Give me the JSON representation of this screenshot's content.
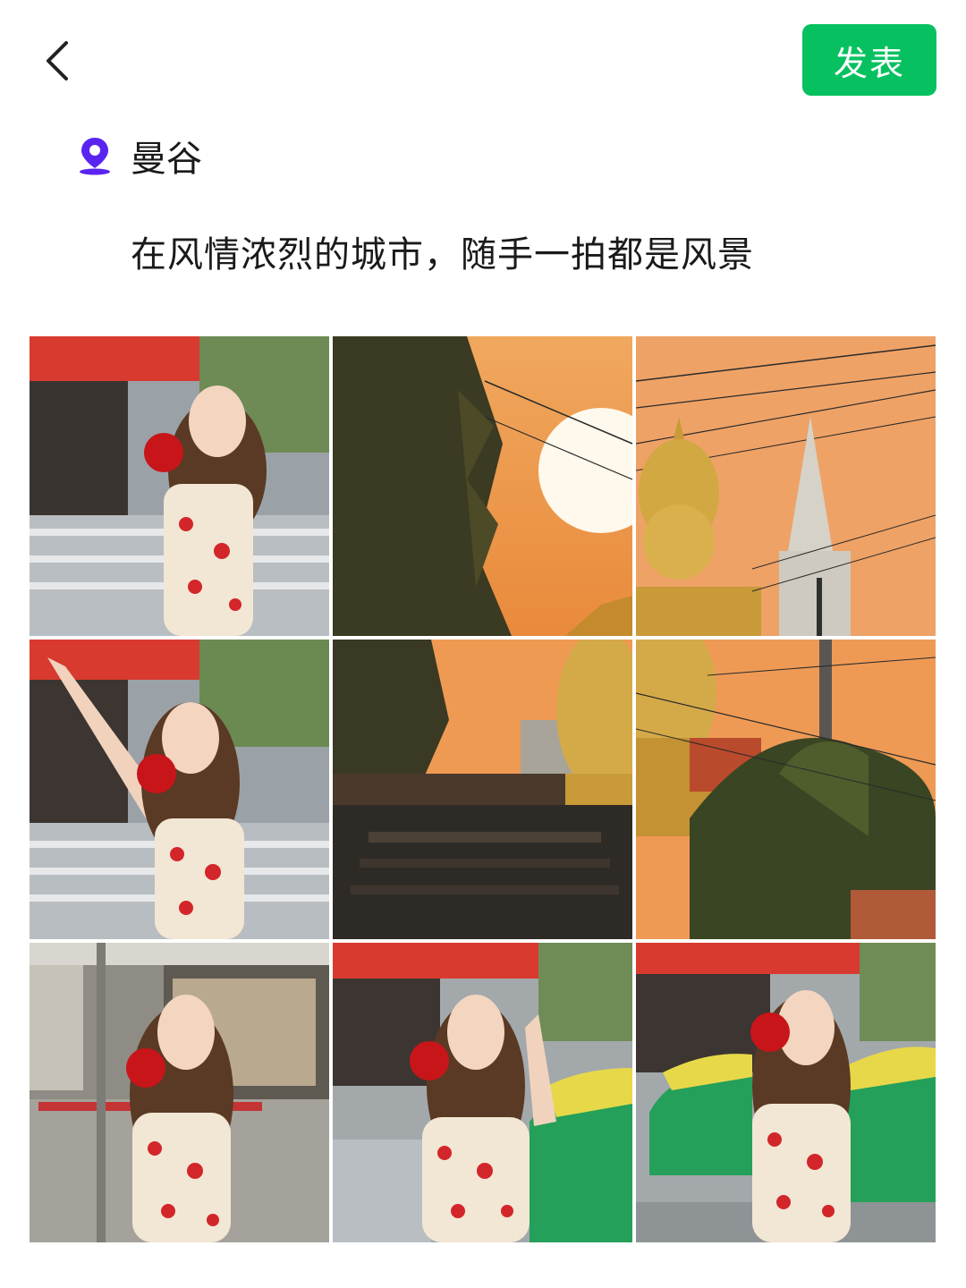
{
  "header": {
    "publish_label": "发表"
  },
  "post": {
    "location": "曼谷",
    "caption": "在风情浓烈的城市，随手一拍都是风景"
  },
  "icons": {
    "back": "chevron-left-icon",
    "location": "location-pin-icon"
  },
  "colors": {
    "accent_green": "#07c160",
    "location_purple": "#5a24f0"
  },
  "photos": [
    "street-portrait-photo",
    "sunset-sun-photo",
    "buddha-temple-photo",
    "street-portrait-waving-photo",
    "sunset-rooftops-photo",
    "powerlines-trees-photo",
    "storefront-portrait-photo",
    "taxi-portrait-photo",
    "taxi-portrait-smiling-photo"
  ]
}
